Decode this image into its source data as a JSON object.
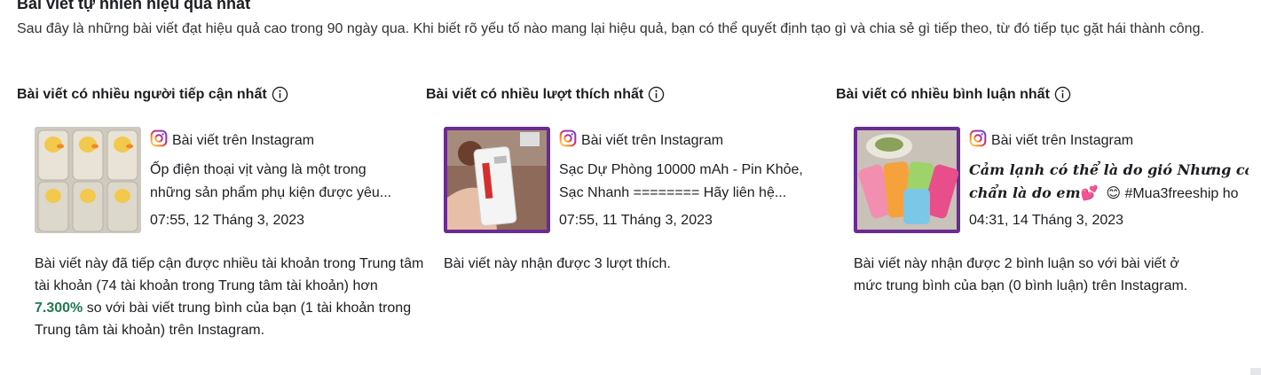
{
  "section": {
    "title": "Bài viết tự nhiên hiệu quả nhất",
    "intro": "Sau đây là những bài viết đạt hiệu quả cao trong 90 ngày qua. Khi biết rõ yếu tố nào mang lại hiệu quả, bạn có thể quyết định tạo gì và chia sẻ gì tiếp theo, từ đó tiếp tục gặt hái thành công."
  },
  "columns": [
    {
      "title": "Bài viết có nhiều người tiếp cận nhất",
      "source": "Bài viết trên Instagram",
      "caption_line1": "Ốp điện thoại vịt vàng là một trong",
      "caption_line2": "những sản phẩm phụ kiện được yêu...",
      "date": "07:55, 12 Tháng 3, 2023",
      "desc_before": "Bài viết này đã tiếp cận được nhiều tài khoản trong Trung tâm tài khoản (74 tài khoản trong Trung tâm tài khoản) hơn ",
      "desc_highlight": "7.300%",
      "desc_after": " so với bài viết trung bình của bạn (1 tài khoản trong Trung tâm tài khoản) trên Instagram."
    },
    {
      "title": "Bài viết có nhiều lượt thích nhất",
      "source": "Bài viết trên Instagram",
      "caption_line1": "Sạc Dự Phòng 10000 mAh - Pin Khỏe,",
      "caption_line2": "Sạc Nhanh ======== Hãy liên hệ...",
      "date": "07:55, 11 Tháng 3, 2023",
      "desc": "Bài viết này nhận được 3 lượt thích."
    },
    {
      "title": "Bài viết có nhiều bình luận nhất",
      "source": "Bài viết trên Instagram",
      "caption_line1_styled": "Cảm lạnh có thể là do gió Nhưng cả",
      "caption_line2_styled": "chẩn là do em",
      "caption_emoji1": "💕",
      "caption_emoji2": "😊",
      "caption_tag": "#Mua3freeship ho",
      "date": "04:31, 14 Tháng 3, 2023",
      "desc": "Bài viết này nhận được 2 bình luận so với bài viết ở mức trung bình của bạn (0 bình luận) trên Instagram."
    }
  ],
  "colors": {
    "highlight_green": "#1f7a4d",
    "thumb_border_purple": "#6a2c91",
    "instagram_gradient": [
      "#feda75",
      "#fa7e1e",
      "#d62976",
      "#962fbf",
      "#4f5bd5"
    ]
  },
  "icons": [
    "info-icon",
    "instagram-icon"
  ]
}
